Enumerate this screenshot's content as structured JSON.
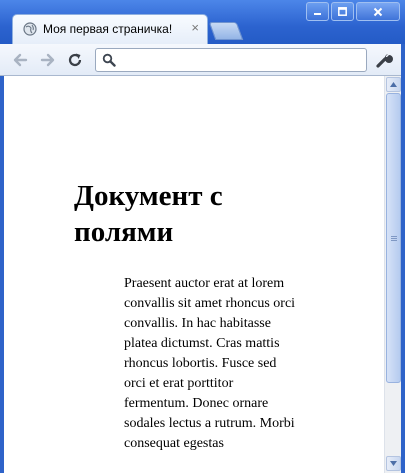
{
  "tab": {
    "title": "Моя первая страничка!",
    "close_glyph": "×"
  },
  "window_controls": {
    "minimize": "minimize-icon",
    "maximize": "maximize-icon",
    "close": "close-icon"
  },
  "toolbar": {
    "back_icon": "back-arrow-icon",
    "forward_icon": "forward-arrow-icon",
    "reload_icon": "reload-icon",
    "omnibox": {
      "value": "",
      "icon": "search-icon"
    },
    "menu_icon": "wrench-icon"
  },
  "page": {
    "heading": "Документ с полями",
    "paragraph": "Praesent auctor erat at lorem convallis sit amet rhoncus orci convallis. In hac habitasse platea dictumst. Cras mattis rhoncus lobortis. Fusce sed orci et erat porttitor fermentum. Donec ornare sodales lectus a rutrum. Morbi consequat egestas"
  },
  "colors": {
    "frame": "#2e63c9",
    "toolbar": "#e3ebf7"
  }
}
